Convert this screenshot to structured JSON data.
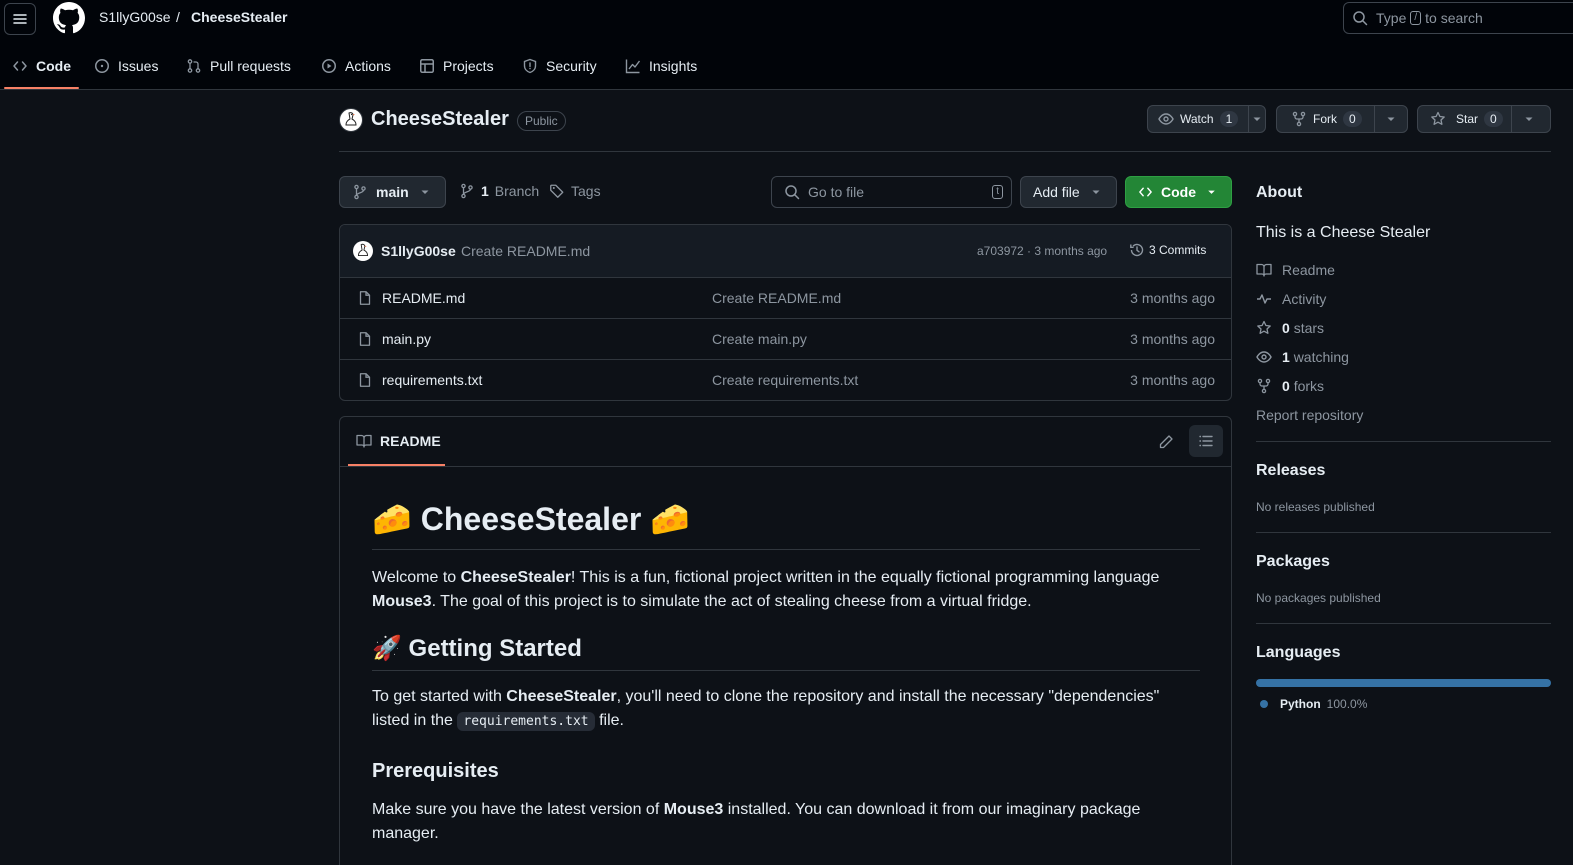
{
  "header": {
    "owner": "S1llyG00se",
    "separator": "/",
    "repo": "CheeseStealer",
    "search_prefix": "Type",
    "search_key": "/",
    "search_suffix": "to search"
  },
  "tabs": [
    {
      "label": "Code",
      "icon": "code-icon"
    },
    {
      "label": "Issues",
      "icon": "issue-opened-icon"
    },
    {
      "label": "Pull requests",
      "icon": "git-pull-request-icon"
    },
    {
      "label": "Actions",
      "icon": "play-icon"
    },
    {
      "label": "Projects",
      "icon": "table-icon"
    },
    {
      "label": "Security",
      "icon": "shield-icon"
    },
    {
      "label": "Insights",
      "icon": "graph-icon"
    }
  ],
  "repo": {
    "title": "CheeseStealer",
    "visibility": "Public",
    "watch_label": "Watch",
    "watch_count": "1",
    "fork_label": "Fork",
    "fork_count": "0",
    "star_label": "Star",
    "star_count": "0"
  },
  "filebar": {
    "branch": "main",
    "branch_count": "1",
    "branch_label": "Branch",
    "tags_label": "Tags",
    "goto_placeholder": "Go to file",
    "goto_key": "t",
    "add_file": "Add file",
    "code": "Code"
  },
  "commit": {
    "author": "S1llyG00se",
    "message": "Create README.md",
    "meta": "a703972 · 3 months ago",
    "commits": "3 Commits"
  },
  "files": [
    {
      "name": "README.md",
      "message": "Create README.md",
      "time": "3 months ago"
    },
    {
      "name": "main.py",
      "message": "Create main.py",
      "time": "3 months ago"
    },
    {
      "name": "requirements.txt",
      "message": "Create requirements.txt",
      "time": "3 months ago"
    }
  ],
  "readme": {
    "tab": "README",
    "h1": "🧀 CheeseStealer 🧀",
    "p1_a": "Welcome to ",
    "p1_b": "CheeseStealer",
    "p1_c": "! This is a fun, fictional project written in the equally fictional programming language ",
    "p1_d": "Mouse3",
    "p1_e": ". The goal of this project is to simulate the act of stealing cheese from a virtual fridge.",
    "h2": "🚀 Getting Started",
    "p2_a": "To get started with ",
    "p2_b": "CheeseStealer",
    "p2_c": ", you'll need to clone the repository and install the necessary \"dependencies\" listed in the ",
    "p2_code": "requirements.txt",
    "p2_d": " file.",
    "h3": "Prerequisites",
    "p3_a": "Make sure you have the latest version of ",
    "p3_b": "Mouse3",
    "p3_c": " installed. You can download it from our imaginary package manager."
  },
  "about": {
    "heading": "About",
    "description": "This is a Cheese Stealer",
    "readme": "Readme",
    "activity": "Activity",
    "stars_count": "0",
    "stars_label": "stars",
    "watching_count": "1",
    "watching_label": "watching",
    "forks_count": "0",
    "forks_label": "forks",
    "report": "Report repository"
  },
  "releases": {
    "heading": "Releases",
    "text": "No releases published"
  },
  "packages": {
    "heading": "Packages",
    "text": "No packages published"
  },
  "languages": {
    "heading": "Languages",
    "items": [
      {
        "name": "Python",
        "percent": "100.0%",
        "fraction": 1.0,
        "color": "#3572A5"
      }
    ]
  },
  "colors": {
    "accent_underline": "#f78166",
    "code_button": "#238636",
    "link": "#4493f8"
  }
}
